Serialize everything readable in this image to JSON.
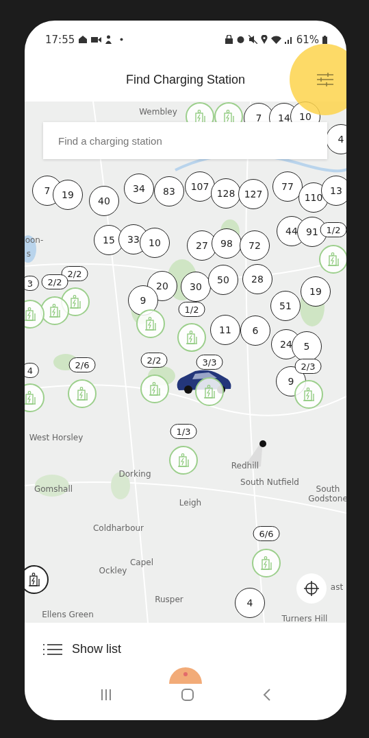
{
  "status_bar": {
    "time": "17:55",
    "battery": "61%"
  },
  "header": {
    "title": "Find Charging Station"
  },
  "search": {
    "placeholder": "Find a charging station"
  },
  "map": {
    "place_names": [
      "Wembley",
      "oon-",
      "s",
      "West Horsley",
      "Dorking",
      "Redhill",
      "Gomshall",
      "South Nutfield",
      "South\nGodstone",
      "Leigh",
      "Coldharbour",
      "Ockley",
      "Capel",
      "ast",
      "Rusper",
      "Ellens Green",
      "Turners Hill"
    ],
    "clusters": [
      {
        "count": "7"
      },
      {
        "count": "14"
      },
      {
        "count": "10"
      },
      {
        "count": "4"
      },
      {
        "count": "7"
      },
      {
        "count": "19"
      },
      {
        "count": "40"
      },
      {
        "count": "34"
      },
      {
        "count": "83"
      },
      {
        "count": "107"
      },
      {
        "count": "128"
      },
      {
        "count": "127"
      },
      {
        "count": "77"
      },
      {
        "count": "110"
      },
      {
        "count": "13"
      },
      {
        "count": "15"
      },
      {
        "count": "33"
      },
      {
        "count": "10"
      },
      {
        "count": "27"
      },
      {
        "count": "98"
      },
      {
        "count": "72"
      },
      {
        "count": "44"
      },
      {
        "count": "91"
      },
      {
        "count": "20"
      },
      {
        "count": "9"
      },
      {
        "count": "30"
      },
      {
        "count": "50"
      },
      {
        "count": "28"
      },
      {
        "count": "19"
      },
      {
        "count": "51"
      },
      {
        "count": "11"
      },
      {
        "count": "6"
      },
      {
        "count": "24"
      },
      {
        "count": "5"
      },
      {
        "count": "9"
      },
      {
        "count": "4"
      }
    ],
    "stations": [
      {
        "kind": "available",
        "availability": "1/2"
      },
      {
        "kind": "available",
        "availability": "2/2"
      },
      {
        "kind": "available",
        "availability": "2/2"
      },
      {
        "kind": "available",
        "availability": "3"
      },
      {
        "kind": "available"
      },
      {
        "kind": "available",
        "availability": "1/2"
      },
      {
        "kind": "available",
        "availability": "4"
      },
      {
        "kind": "available",
        "availability": "2/6"
      },
      {
        "kind": "available",
        "availability": "2/2"
      },
      {
        "kind": "available",
        "availability": "3/3"
      },
      {
        "kind": "available",
        "availability": "2/3"
      },
      {
        "kind": "available",
        "availability": "1/3"
      },
      {
        "kind": "available",
        "availability": "6/6"
      },
      {
        "kind": "selected"
      },
      {
        "kind": "available"
      },
      {
        "kind": "available"
      }
    ]
  },
  "bottom": {
    "show_list": "Show list"
  }
}
